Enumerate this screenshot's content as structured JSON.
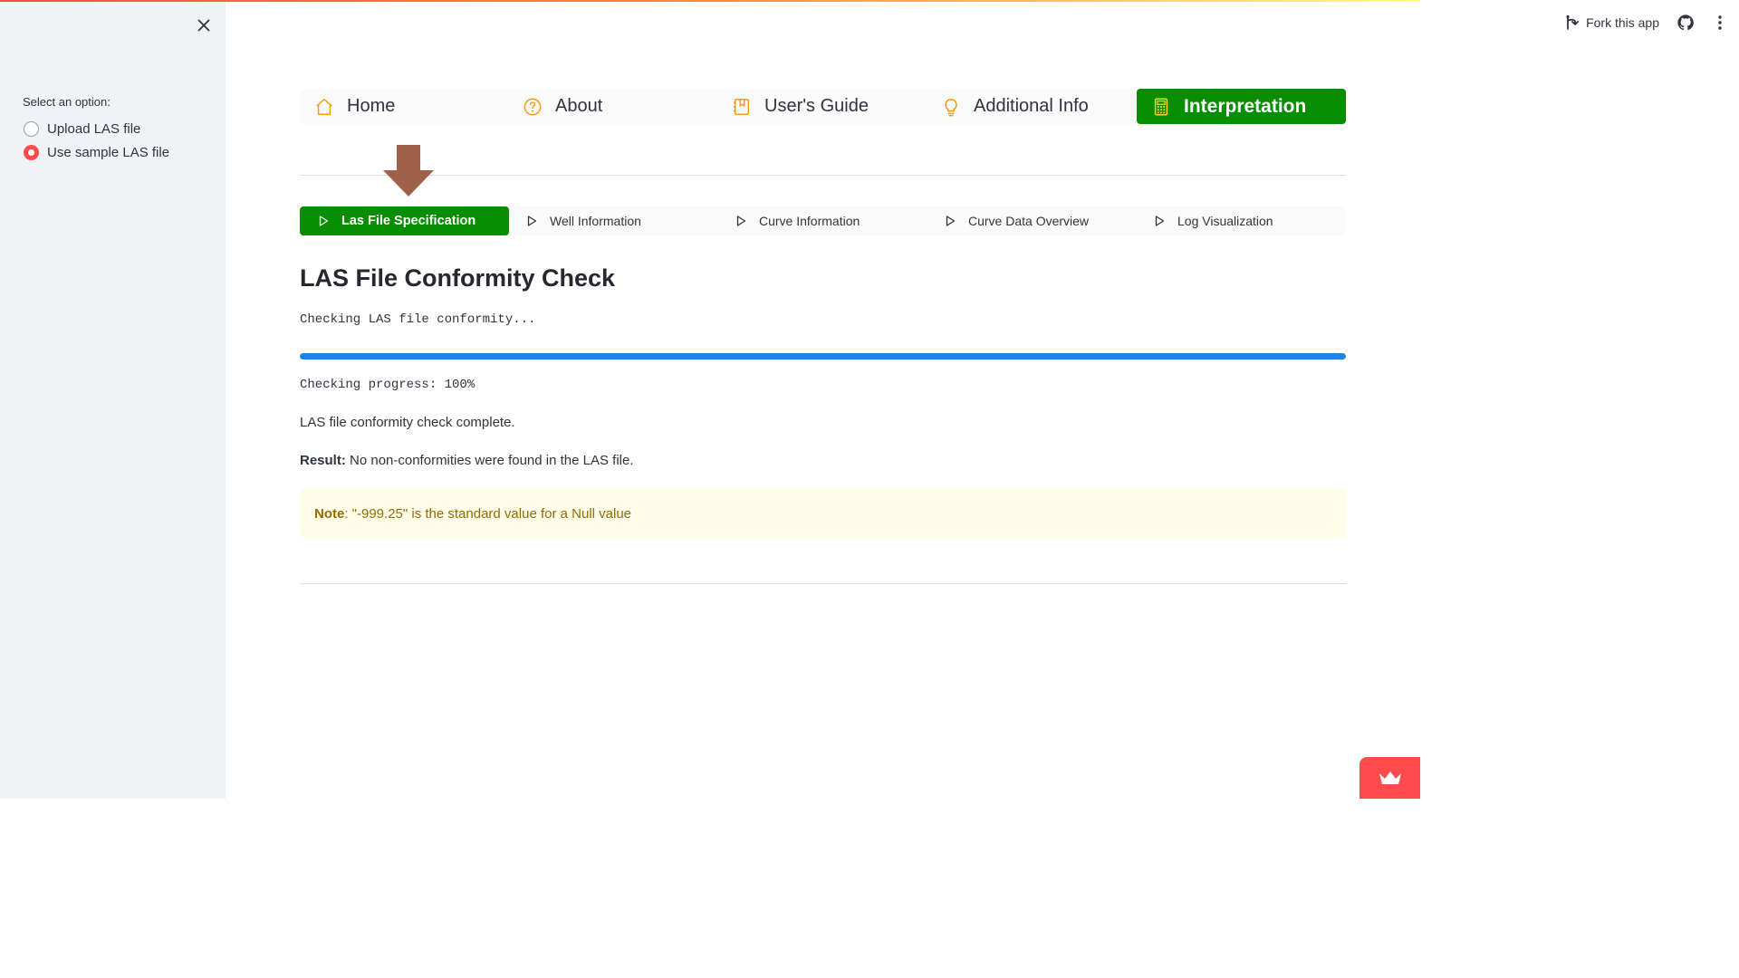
{
  "header": {
    "fork_label": "Fork this app"
  },
  "sidebar": {
    "radio_label": "Select an option:",
    "options": [
      {
        "label": "Upload LAS file",
        "selected": false
      },
      {
        "label": "Use sample LAS file",
        "selected": true
      }
    ]
  },
  "main_nav": {
    "items": [
      {
        "label": "Home",
        "icon": "house-icon"
      },
      {
        "label": "About",
        "icon": "question-circle-icon"
      },
      {
        "label": "User's Guide",
        "icon": "journal-bookmark-icon"
      },
      {
        "label": "Additional Info",
        "icon": "lightbulb-icon"
      },
      {
        "label": "Interpretation",
        "icon": "calculator-icon",
        "active": true
      }
    ]
  },
  "sub_nav": {
    "items": [
      {
        "label": "Las File Specification",
        "active": true
      },
      {
        "label": "Well Information"
      },
      {
        "label": "Curve Information"
      },
      {
        "label": "Curve Data Overview"
      },
      {
        "label": "Log Visualization"
      }
    ]
  },
  "content": {
    "title": "LAS File Conformity Check",
    "checking_text": "Checking LAS file conformity...",
    "progress_percent": 100,
    "progress_text": "Checking progress: 100%",
    "complete_text": "LAS file conformity check complete.",
    "result_label": "Result:",
    "result_text": " No non-conformities were found in the LAS file.",
    "note_label": "Note",
    "note_text": ": \"-999.25\" is the standard value for a Null value"
  },
  "colors": {
    "accent_green": "#078d00",
    "primary_red": "#ff4b4b",
    "progress_blue": "#1c83e1",
    "icon_orange": "#f39c12",
    "arrow_brown": "#a0614b"
  }
}
